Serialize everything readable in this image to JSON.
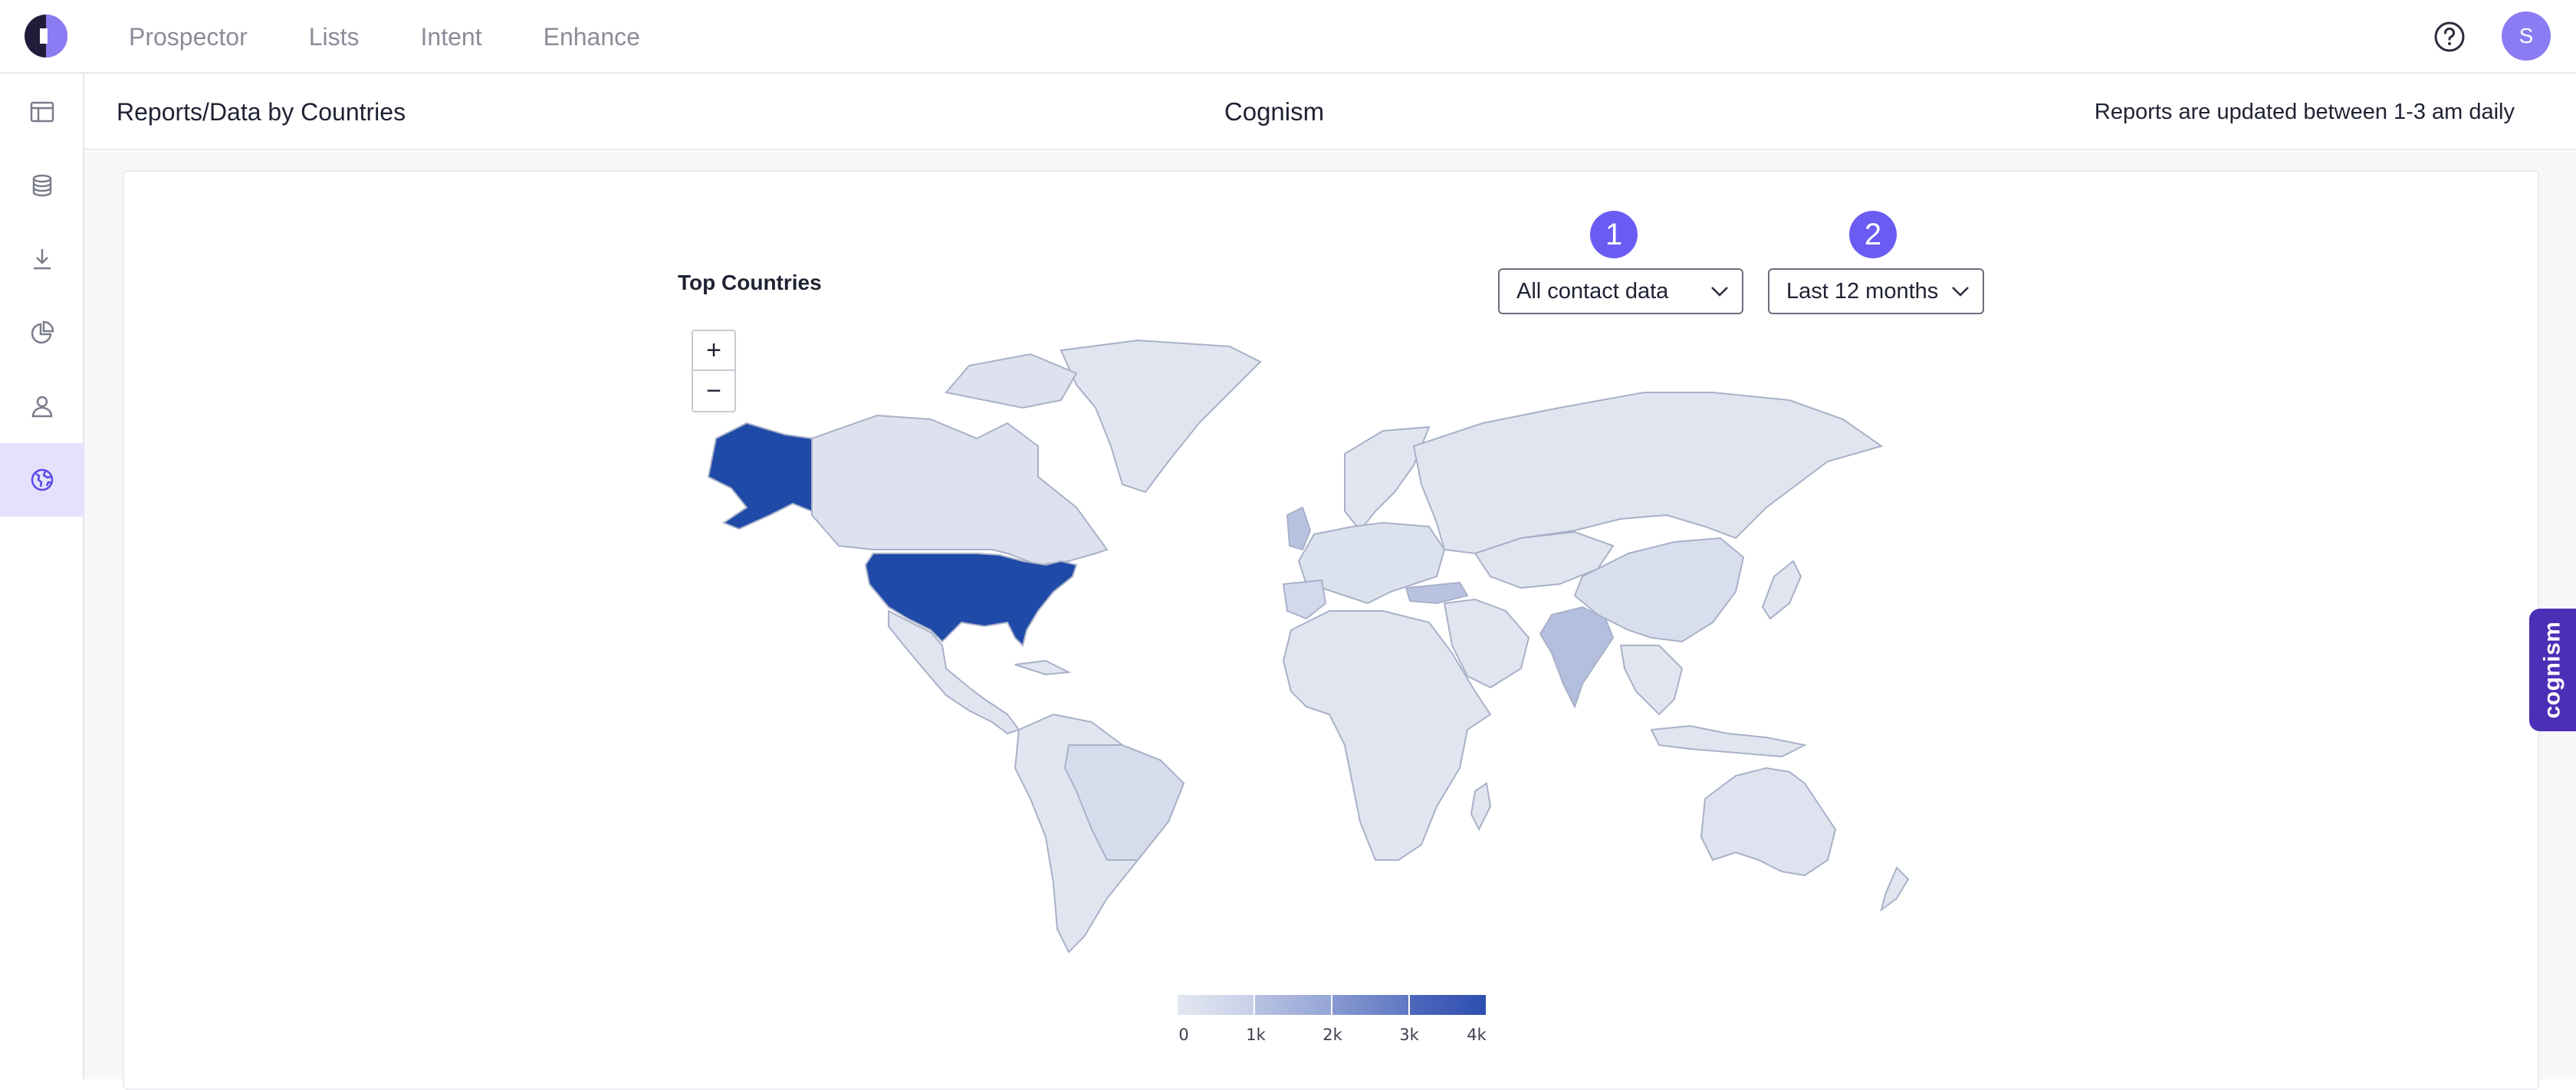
{
  "topnav": {
    "items": [
      {
        "label": "Prospector"
      },
      {
        "label": "Lists"
      },
      {
        "label": "Intent"
      },
      {
        "label": "Enhance"
      }
    ],
    "avatar_initial": "S"
  },
  "sidebar": {
    "items": [
      {
        "icon": "layout-icon",
        "active": false
      },
      {
        "icon": "database-icon",
        "active": false
      },
      {
        "icon": "download-icon",
        "active": false
      },
      {
        "icon": "pie-chart-icon",
        "active": false
      },
      {
        "icon": "user-icon",
        "active": false
      },
      {
        "icon": "globe-icon",
        "active": true
      }
    ]
  },
  "header": {
    "page_title": "Reports/Data by Countries",
    "center_title": "Cognism",
    "update_note": "Reports are updated between 1-3 am daily"
  },
  "report": {
    "title": "Top Countries",
    "step1": "1",
    "step2": "2",
    "data_filter": "All contact data",
    "period_filter": "Last 12 months",
    "zoom_in": "+",
    "zoom_out": "−"
  },
  "legend": {
    "labels": [
      "0",
      "1k",
      "2k",
      "3k",
      "4k"
    ],
    "colors": [
      "#dde2ee",
      "#a9b6da",
      "#7c8fcc",
      "#4e68bf",
      "#1e3ea8"
    ]
  },
  "colors": {
    "accent": "#6a5cf3",
    "sidebar_active": "#e5e1fc",
    "brand_tab": "#4b2fb6",
    "map_default": "#e0e5f0",
    "map_highest": "#1f4aa8"
  },
  "side_tab": {
    "label": "cognism"
  }
}
